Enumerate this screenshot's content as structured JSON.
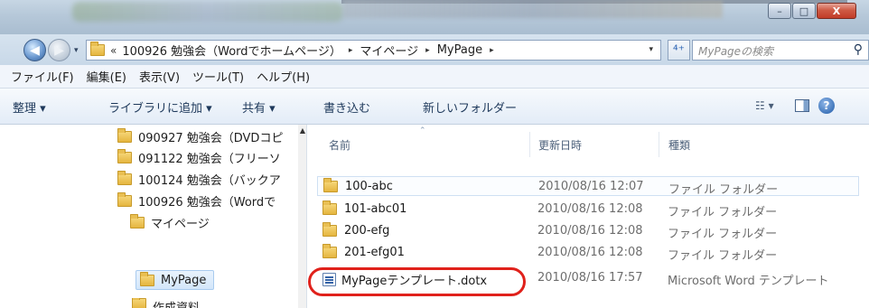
{
  "window": {
    "min_glyph": "–",
    "max_glyph": "□",
    "close_glyph": "X"
  },
  "address": {
    "overflow": "«",
    "crumbs": [
      "100926 勉強会（Wordでホームページ）",
      "マイページ",
      "MyPage"
    ],
    "separator": "▸",
    "dropdown": "▾",
    "refresh": "⁴⁺",
    "search_placeholder": "MyPageの検索",
    "search_icon": "magnifier-icon"
  },
  "menu": [
    "ファイル(F)",
    "編集(E)",
    "表示(V)",
    "ツール(T)",
    "ヘルプ(H)"
  ],
  "commands": {
    "organize": "整理 ▾",
    "add_to_library": "ライブラリに追加 ▾",
    "share": "共有 ▾",
    "burn": "書き込む",
    "new_folder": "新しいフォルダー",
    "views": "☷ ▾",
    "help": "?"
  },
  "tree": [
    "090927 勉強会（DVDコピ",
    "091122 勉強会（フリーソ",
    "100124 勉強会（バックア",
    "100926 勉強会（Wordで",
    "マイページ",
    "MyPage",
    "作成資料"
  ],
  "columns": {
    "name": "名前",
    "modified": "更新日時",
    "type": "種類"
  },
  "files": [
    {
      "name": "100-abc",
      "date": "2010/08/16 12:07",
      "type": "ファイル フォルダー",
      "icon": "folder-icon"
    },
    {
      "name": "101-abc01",
      "date": "2010/08/16 12:08",
      "type": "ファイル フォルダー",
      "icon": "folder-icon"
    },
    {
      "name": "200-efg",
      "date": "2010/08/16 12:08",
      "type": "ファイル フォルダー",
      "icon": "folder-icon"
    },
    {
      "name": "201-efg01",
      "date": "2010/08/16 12:08",
      "type": "ファイル フォルダー",
      "icon": "folder-icon"
    },
    {
      "name": "MyPageテンプレート.dotx",
      "date": "2010/08/16 17:57",
      "type": "Microsoft Word テンプレート",
      "icon": "word-template-icon"
    }
  ],
  "colors": {
    "highlight_circle": "#e0211b",
    "close_button": "#c23c28"
  }
}
